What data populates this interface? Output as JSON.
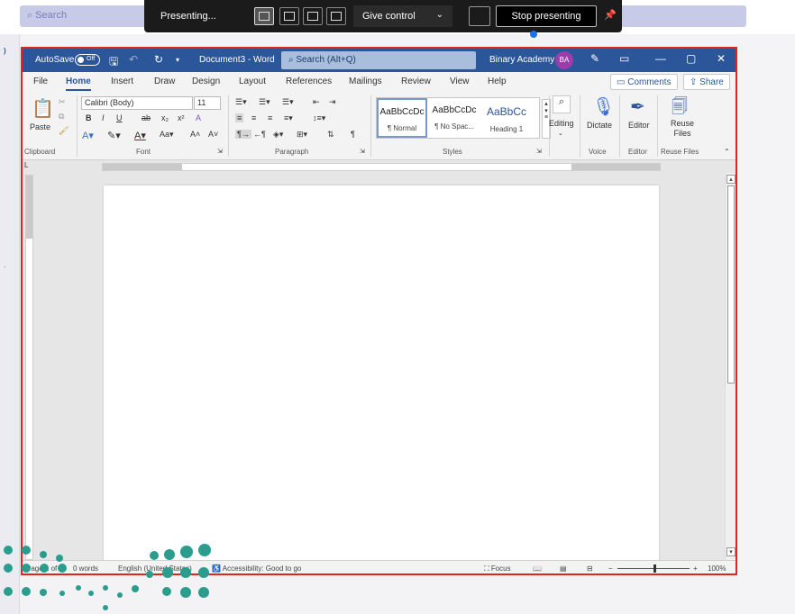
{
  "teams": {
    "search_placeholder": "Search"
  },
  "presenting_bar": {
    "label": "Presenting...",
    "give_control": "Give control",
    "stop": "Stop presenting"
  },
  "word": {
    "titlebar": {
      "autosave": "AutoSave",
      "autosave_state": "Off",
      "doc_title": "Document3 - Word",
      "search": "Search (Alt+Q)",
      "user": "Binary Academy",
      "avatar": "BA"
    },
    "tabs": [
      "File",
      "Home",
      "Insert",
      "Draw",
      "Design",
      "Layout",
      "References",
      "Mailings",
      "Review",
      "View",
      "Help"
    ],
    "comments": "Comments",
    "share": "Share",
    "ribbon": {
      "paste": "Paste",
      "font_name": "Calibri (Body)",
      "font_size": "11",
      "styles": [
        {
          "sample": "AaBbCcDc",
          "name": "¶ Normal"
        },
        {
          "sample": "AaBbCcDc",
          "name": "¶ No Spac..."
        },
        {
          "sample": "AaBbCc",
          "name": "Heading 1"
        }
      ],
      "editing": "Editing",
      "dictate": "Dictate",
      "editor": "Editor",
      "reuse_files": "Reuse Files",
      "groups": {
        "clipboard": "Clipboard",
        "font": "Font",
        "paragraph": "Paragraph",
        "styles": "Styles",
        "voice": "Voice",
        "editor": "Editor",
        "reuse": "Reuse Files"
      }
    },
    "status": {
      "page": "Page 1 of 1",
      "words": "0 words",
      "language": "English (United States)",
      "accessibility": "Accessibility: Good to go",
      "focus": "Focus",
      "zoom": "100%"
    }
  },
  "colors": {
    "word_blue": "#2b579a",
    "highlight_border": "#e02424",
    "logo_teal": "#2a9d8f"
  }
}
